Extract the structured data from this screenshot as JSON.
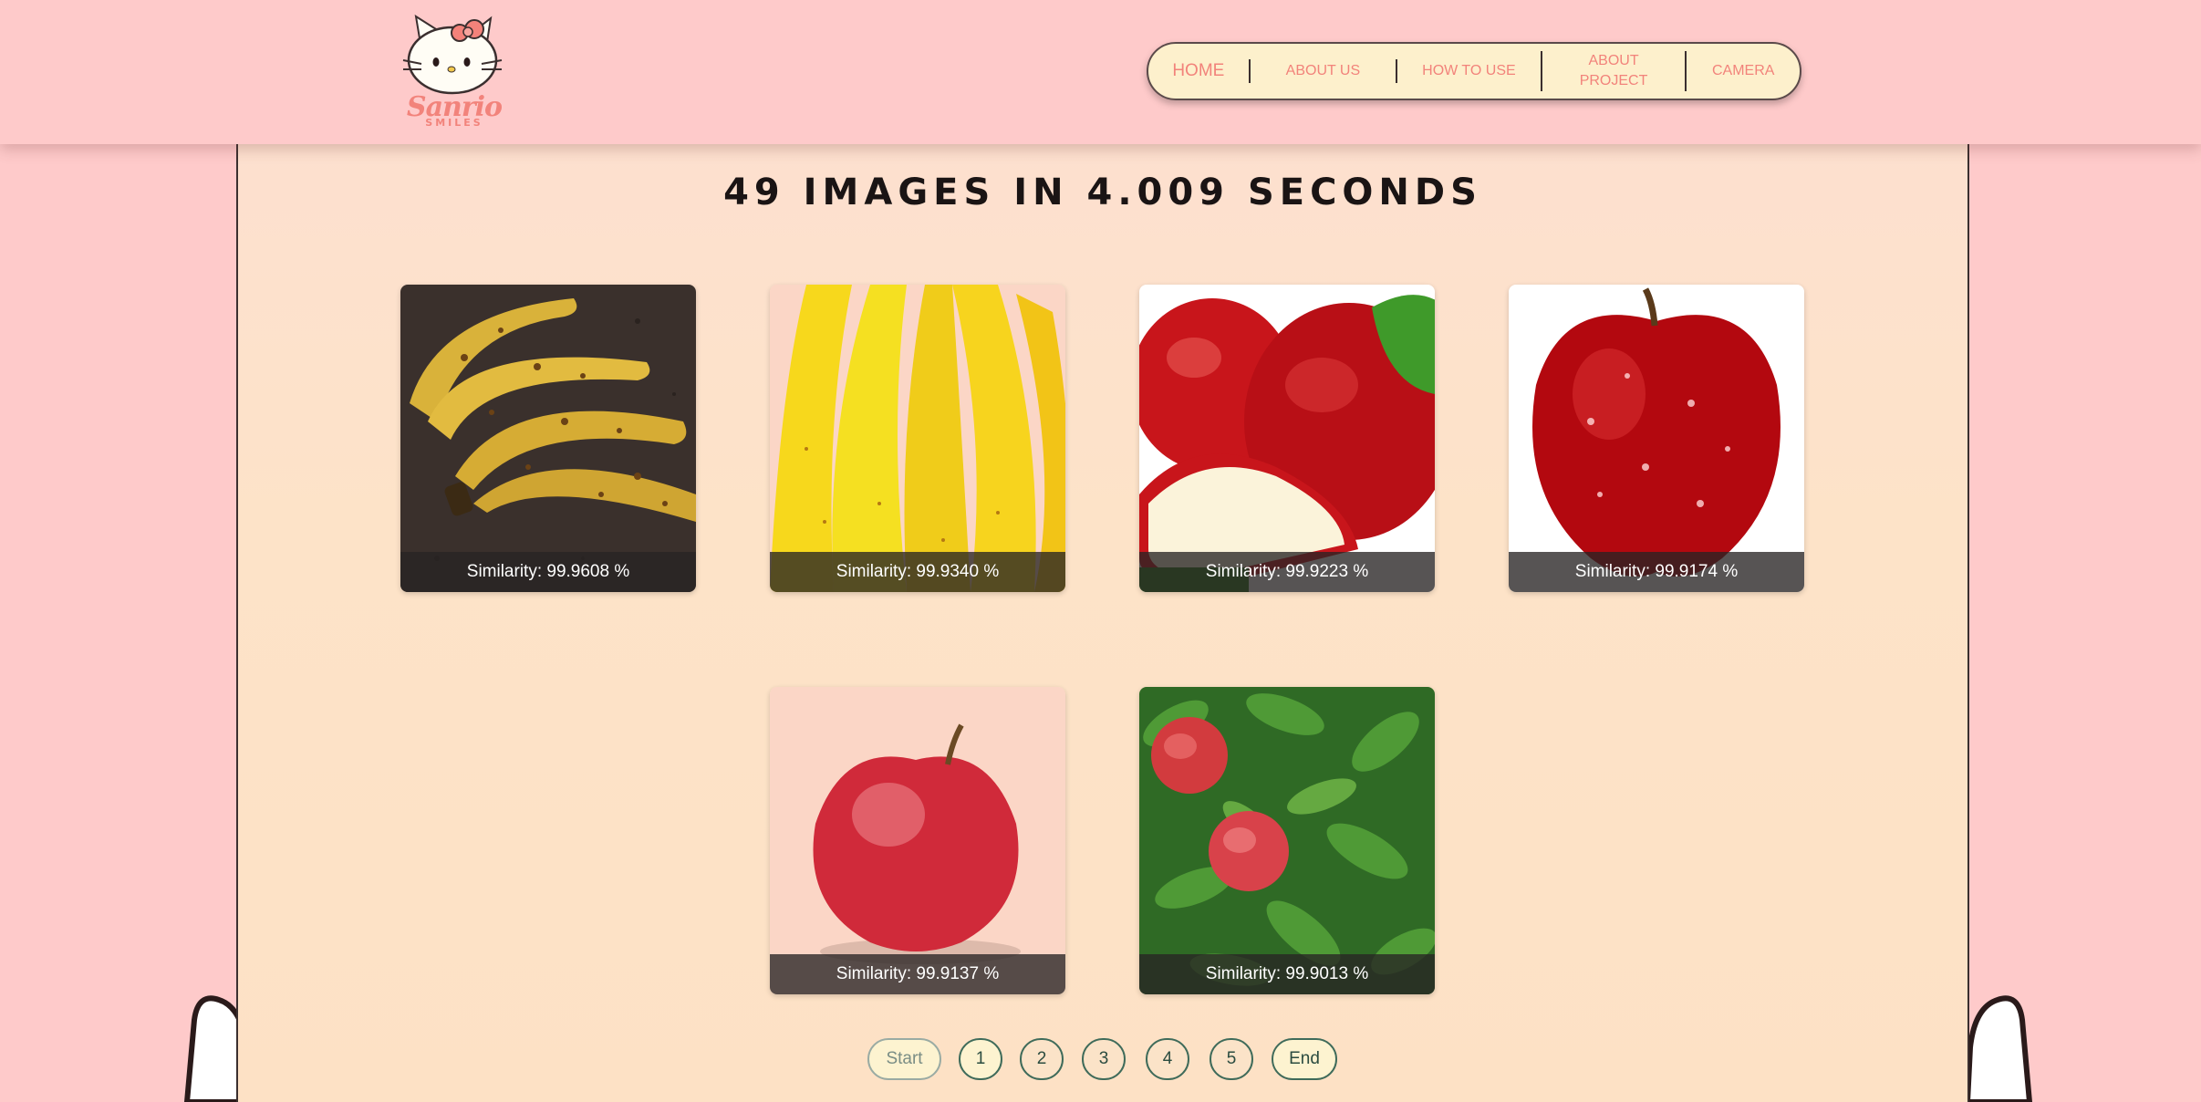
{
  "header": {
    "logo": {
      "brand": "Sanrio",
      "tagline": "SMILES",
      "icon": "hello-kitty-icon"
    },
    "nav": [
      {
        "label": "HOME"
      },
      {
        "label": "ABOUT US"
      },
      {
        "label": "HOW TO USE"
      },
      {
        "label": "ABOUT PROJECT"
      },
      {
        "label": "CAMERA"
      }
    ]
  },
  "results": {
    "title": "49 IMAGES IN 4.009 SECONDS",
    "cards": [
      {
        "caption": "Similarity: 99.9608 %",
        "subject": "overripe-bananas"
      },
      {
        "caption": "Similarity: 99.9340 %",
        "subject": "yellow-bananas"
      },
      {
        "caption": "Similarity: 99.9223 %",
        "subject": "red-apples-slice"
      },
      {
        "caption": "Similarity: 99.9174 %",
        "subject": "wet-red-apple"
      },
      {
        "caption": "Similarity: 99.9137 %",
        "subject": "red-apple"
      },
      {
        "caption": "Similarity: 99.9013 %",
        "subject": "apples-on-tree"
      }
    ]
  },
  "pagination": {
    "start": "Start",
    "pages": [
      "1",
      "2",
      "3",
      "4",
      "5"
    ],
    "end": "End",
    "current": "1"
  },
  "colors": {
    "background": "#fecaca",
    "panel": "#fde0cf",
    "nav_bg": "#fdf0cc",
    "accent": "#f2837b",
    "pager_border": "#3f6b5a"
  }
}
